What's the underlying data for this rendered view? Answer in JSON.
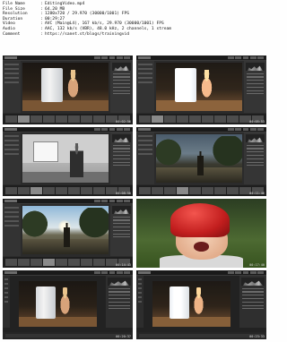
{
  "metadata": [
    {
      "key": "File Name",
      "value": "EditingVideo.mp4"
    },
    {
      "key": "File Size",
      "value": "64.20 MB"
    },
    {
      "key": "Resolution",
      "value": "1280x720 / 29.970 (30000/1001) FPS"
    },
    {
      "key": "Duration",
      "value": "00:29:27"
    },
    {
      "key": "Video",
      "value": "AVC (Main@L4), 167 kb/s, 29.970 (30000/1001) FPS"
    },
    {
      "key": "Audio",
      "value": "AAC, 132 kb/s (VBR), 48.0 kHz, 2 channels, 1 stream"
    },
    {
      "key": "Comment",
      "value": "https://sanet.st/blogs/trainingvid"
    }
  ],
  "thumbnails": [
    {
      "kind": "lightroom",
      "scene": "fridge",
      "timestamp": "00:02:56"
    },
    {
      "kind": "lightroom",
      "scene": "fridge",
      "timestamp": "00:05:53"
    },
    {
      "kind": "lightroom",
      "scene": "office",
      "timestamp": "00:08:50"
    },
    {
      "kind": "lightroom",
      "scene": "dusk",
      "timestamp": "00:11:46"
    },
    {
      "kind": "lightroom",
      "scene": "sunset",
      "timestamp": "00:14:43"
    },
    {
      "kind": "full",
      "scene": "helmet",
      "timestamp": "00:17:40"
    },
    {
      "kind": "photoshop",
      "scene": "fridge",
      "timestamp": "00:20:37"
    },
    {
      "kind": "photoshop",
      "scene": "fridge",
      "timestamp": "00:23:33"
    }
  ]
}
